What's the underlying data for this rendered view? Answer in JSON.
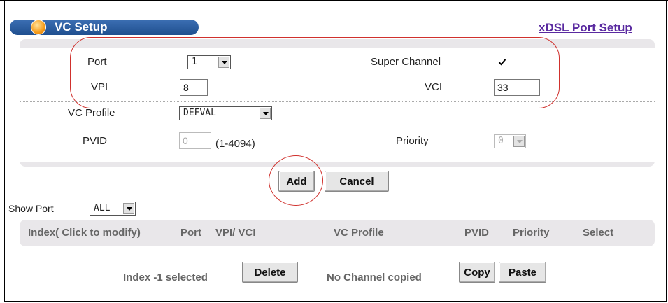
{
  "header": {
    "title": "VC Setup",
    "link_label": "xDSL Port Setup"
  },
  "form": {
    "port": {
      "label": "Port",
      "value": "1"
    },
    "super_channel": {
      "label": "Super Channel",
      "checked": true
    },
    "vpi": {
      "label": "VPI",
      "value": "8"
    },
    "vci": {
      "label": "VCI",
      "value": "33"
    },
    "vc_profile": {
      "label": "VC Profile",
      "value": "DEFVAL"
    },
    "pvid": {
      "label": "PVID",
      "value": "0",
      "hint": "(1-4094)"
    },
    "priority": {
      "label": "Priority",
      "value": "0"
    }
  },
  "actions": {
    "add_label": "Add",
    "cancel_label": "Cancel"
  },
  "show_port": {
    "label": "Show Port",
    "value": "ALL"
  },
  "table": {
    "columns": [
      "Index( Click to modify)",
      "Port",
      "VPI/ VCI",
      "VC Profile",
      "PVID",
      "Priority",
      "Select"
    ]
  },
  "footer": {
    "selected_text": "Index -1 selected",
    "delete_label": "Delete",
    "copied_text": "No Channel copied",
    "copy_label": "Copy",
    "paste_label": "Paste"
  },
  "colors": {
    "title_pill": "#1f4f8f",
    "link": "#5a2aa0",
    "annotation": "#d0312d"
  }
}
